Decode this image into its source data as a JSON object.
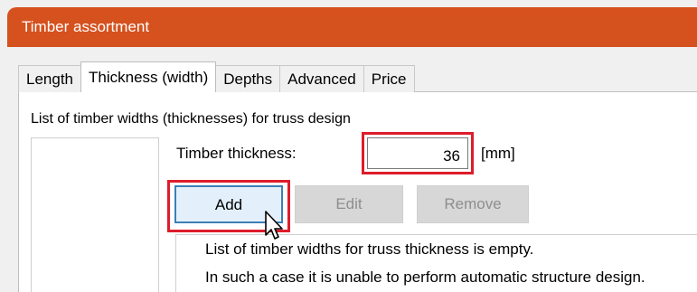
{
  "window": {
    "title": "Timber assortment",
    "titlebar_color": "#d5511e"
  },
  "tabs": [
    {
      "label": "Length",
      "active": false
    },
    {
      "label": "Thickness (width)",
      "active": true
    },
    {
      "label": "Depths",
      "active": false
    },
    {
      "label": "Advanced",
      "active": false
    },
    {
      "label": "Price",
      "active": false
    }
  ],
  "panel": {
    "caption": "List of timber widths (thicknesses) for truss design",
    "thickness_label": "Timber thickness:",
    "thickness_value": "36",
    "thickness_unit": "[mm]",
    "buttons": {
      "add": "Add",
      "edit": "Edit",
      "remove": "Remove"
    },
    "messages": [
      "List of timber widths for truss thickness is empty.",
      "In such a case it is unable to perform automatic structure design."
    ]
  },
  "highlight_color": "#dd1d2c",
  "icons": {
    "cursor": "mouse-pointer-icon"
  }
}
